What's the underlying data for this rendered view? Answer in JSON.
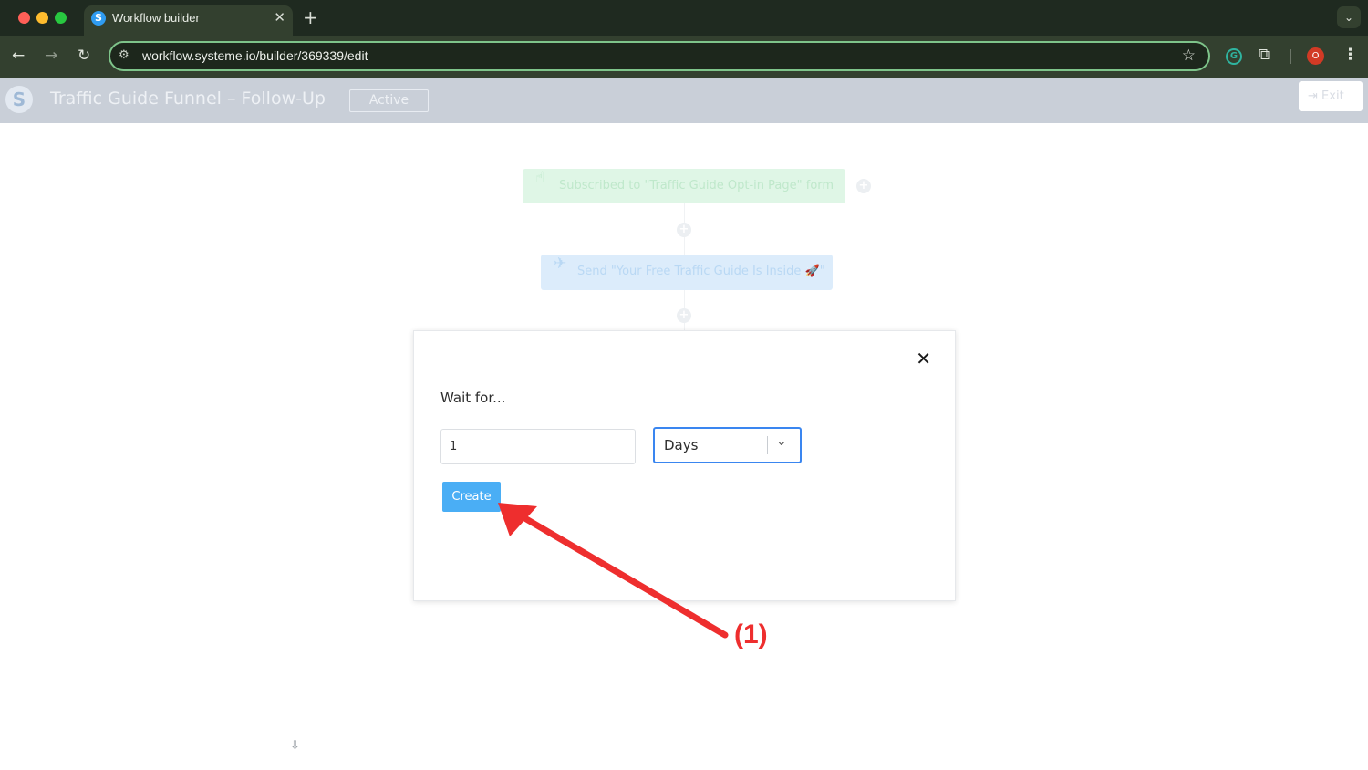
{
  "browser": {
    "tab_title": "Workflow builder",
    "tab_favicon": "S",
    "tab_close": "✕",
    "new_tab": "+",
    "url": "workflow.systeme.io/builder/369339/edit",
    "profile_initial": "O",
    "extension_letter": "G",
    "icons": {
      "back": "arrow-left-icon",
      "forward": "arrow-right-icon",
      "reload": "reload-icon",
      "site_info": "tune-icon",
      "bookmark": "star-icon",
      "extensions": "puzzle-icon",
      "menu": "kebab-icon",
      "tab_search": "chevron-down-icon"
    }
  },
  "header": {
    "logo_letter": "S",
    "title": "Traffic Guide Funnel – Follow-Up",
    "status": "Active",
    "exit_label": "Exit"
  },
  "workflow": {
    "trigger_label": "Subscribed to \"Traffic Guide Opt-in Page\" form",
    "email_label": "Send \"Your Free Traffic Guide Is Inside 🚀\""
  },
  "modal": {
    "label": "Wait for...",
    "duration_value": "1",
    "unit_selected": "Days",
    "create_label": "Create",
    "close_symbol": "✕"
  },
  "annotation": {
    "label": "(1)",
    "color": "#ee2e2e"
  },
  "colors": {
    "accent_blue": "#4aaef5",
    "select_focus": "#3a86f0",
    "browser_bg": "#33402f"
  }
}
